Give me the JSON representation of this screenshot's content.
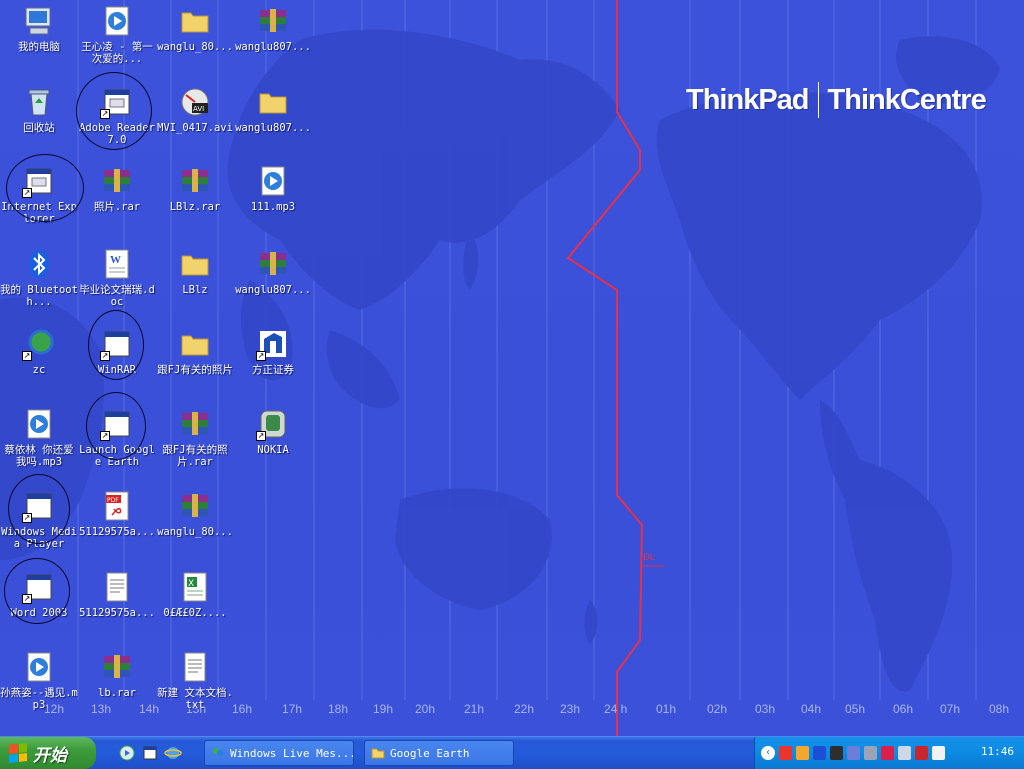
{
  "wallpaper": {
    "brand_left": "ThinkPad",
    "brand_right": "ThinkCentre",
    "hour_labels": [
      "12h",
      "13h",
      "14h",
      "15h",
      "16h",
      "17h",
      "18h",
      "19h",
      "20h",
      "21h",
      "22h",
      "23h",
      "24 h",
      "01h",
      "02h",
      "03h",
      "04h",
      "05h",
      "06h",
      "07h",
      "08h"
    ],
    "dateline_mark": "DL"
  },
  "desktop_icons": [
    {
      "label": "我的电脑",
      "icon": "computer-icon"
    },
    {
      "label": "王心凌 - 第一次爱的...",
      "icon": "media-file-icon"
    },
    {
      "label": "wanglu_80...",
      "icon": "folder-icon"
    },
    {
      "label": "wanglu807...",
      "icon": "rar-archive-icon"
    },
    {
      "label": "回收站",
      "icon": "recycle-bin-icon"
    },
    {
      "label": "Adobe Reader 7.0",
      "icon": "shortcut-app-icon"
    },
    {
      "label": "MVI_0417.avi",
      "icon": "avi-file-icon"
    },
    {
      "label": "wanglu807...",
      "icon": "folder-icon"
    },
    {
      "label": "Internet Explorer",
      "icon": "shortcut-app-icon"
    },
    {
      "label": "照片.rar",
      "icon": "rar-archive-icon"
    },
    {
      "label": "LBlz.rar",
      "icon": "rar-archive-icon"
    },
    {
      "label": "111.mp3",
      "icon": "media-file-icon"
    },
    {
      "label": "我的 Bluetooth...",
      "icon": "bluetooth-icon"
    },
    {
      "label": "毕业论文瑞瑞.doc",
      "icon": "word-document-icon"
    },
    {
      "label": "LBlz",
      "icon": "folder-icon"
    },
    {
      "label": "wanglu807...",
      "icon": "rar-archive-icon"
    },
    {
      "label": "zc",
      "icon": "network-shortcut-icon"
    },
    {
      "label": "WinRAR",
      "icon": "shortcut-app-icon"
    },
    {
      "label": "跟FJ有关的照片",
      "icon": "folder-icon"
    },
    {
      "label": "方正证券",
      "icon": "founder-securities-icon"
    },
    {
      "label": "蔡依林 你还爱我吗.mp3",
      "icon": "media-file-icon"
    },
    {
      "label": "Launch Google Earth",
      "icon": "shortcut-app-icon"
    },
    {
      "label": "跟FJ有关的照片.rar",
      "icon": "rar-archive-icon"
    },
    {
      "label": "NOKIA",
      "icon": "nokia-icon"
    },
    {
      "label": "Windows Media Player",
      "icon": "shortcut-app-icon"
    },
    {
      "label": "51129575a...",
      "icon": "pdf-file-icon"
    },
    {
      "label": "wanglu_80...",
      "icon": "rar-archive-icon"
    },
    {
      "label": "Word 2003",
      "icon": "shortcut-app-icon"
    },
    {
      "label": "51129575a...",
      "icon": "text-file-icon"
    },
    {
      "label": "0£Æ£0Z....",
      "icon": "excel-file-icon"
    },
    {
      "label": "孙燕姿--遇见.mp3",
      "icon": "media-file-icon"
    },
    {
      "label": "lb.rar",
      "icon": "rar-archive-icon"
    },
    {
      "label": "新建 文本文档.txt",
      "icon": "text-file-icon"
    }
  ],
  "taskbar": {
    "start_label": "开始",
    "tasks": [
      {
        "label": "Windows Live Mes...",
        "icon": "messenger-icon"
      },
      {
        "label": "Google Earth",
        "icon": "folder-icon"
      }
    ],
    "clock": "11:46"
  }
}
